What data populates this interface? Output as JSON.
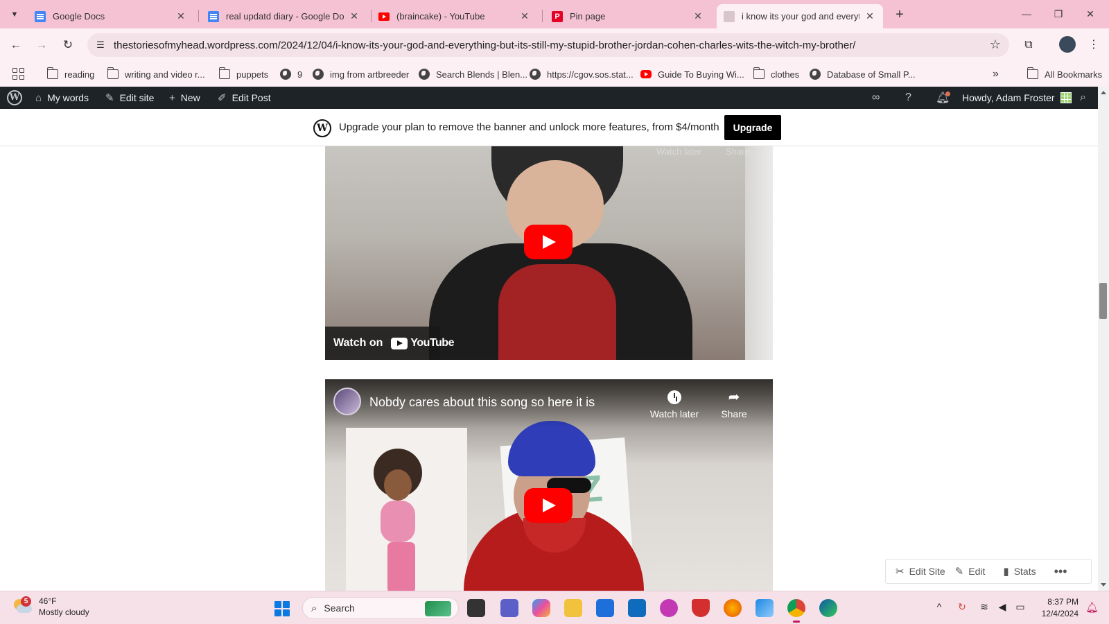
{
  "browser": {
    "tabs": [
      {
        "title": "Google Docs",
        "icon": "google-docs-icon"
      },
      {
        "title": "real updatd diary - Google Doc",
        "icon": "google-docs-icon"
      },
      {
        "title": "(braincake) - YouTube",
        "icon": "youtube-icon"
      },
      {
        "title": "Pin page",
        "icon": "pinterest-icon"
      },
      {
        "title": "i know its your god and everyth",
        "icon": "page-favicon",
        "active": true
      }
    ],
    "url": "thestoriesofmyhead.wordpress.com/2024/12/04/i-know-its-your-god-and-everything-but-its-still-my-stupid-brother-jordan-cohen-charles-wits-the-witch-my-brother/",
    "bookmarks": [
      {
        "label": "reading",
        "icon": "folder-icon"
      },
      {
        "label": "writing and video r...",
        "icon": "folder-icon"
      },
      {
        "label": "puppets",
        "icon": "folder-icon"
      },
      {
        "label": "9",
        "icon": "globe-icon"
      },
      {
        "label": "img from artbreeder",
        "icon": "globe-icon"
      },
      {
        "label": "Search Blends | Blen...",
        "icon": "globe-icon"
      },
      {
        "label": "https://cgov.sos.stat...",
        "icon": "globe-icon"
      },
      {
        "label": "Guide To Buying Wi...",
        "icon": "youtube-icon"
      },
      {
        "label": "clothes",
        "icon": "folder-icon"
      },
      {
        "label": "Database of Small P...",
        "icon": "globe-icon"
      }
    ],
    "all_bookmarks": "All Bookmarks"
  },
  "wp_admin": {
    "my_words": "My words",
    "edit_site": "Edit site",
    "new": "New",
    "edit_post": "Edit Post",
    "howdy": "Howdy, Adam Froster"
  },
  "banner": {
    "text": "Upgrade your plan to remove the banner and unlock more features, from $4/month",
    "button": "Upgrade"
  },
  "videos": [
    {
      "watch_on": "Watch on",
      "youtube_wordmark": "YouTube",
      "faded_watch_later": "Watch later",
      "faded_share": "Share"
    },
    {
      "title": "Nobdy cares about this song so here it is",
      "watch_later": "Watch later",
      "share": "Share"
    }
  ],
  "jetpack": {
    "edit_site": "Edit Site",
    "edit": "Edit",
    "stats": "Stats"
  },
  "taskbar": {
    "weather_temp": "46°F",
    "weather_desc": "Mostly cloudy",
    "weather_badge": "5",
    "search": "Search",
    "time": "8:37 PM",
    "date": "12/4/2024"
  },
  "colors": {
    "tab_strip": "#f5c2d4",
    "toolbar": "#fdf0f4",
    "wp_admin_bar": "#1d2327",
    "youtube_red": "#ff0000"
  }
}
